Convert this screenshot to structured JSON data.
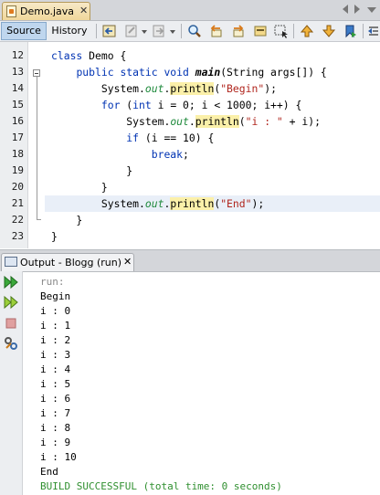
{
  "editor": {
    "file_tab": {
      "label": "Demo.java",
      "close": "✕"
    },
    "toolbar": {
      "source_label": "Source",
      "history_label": "History"
    },
    "line_numbers": [
      "12",
      "13",
      "14",
      "15",
      "16",
      "17",
      "18",
      "19",
      "20",
      "21",
      "22",
      "23"
    ],
    "code": {
      "l12": {
        "kw1": "class",
        "rest": " Demo {"
      },
      "l13": {
        "indent": "    ",
        "kw": "public static void",
        "sp": " ",
        "method": "main",
        "rest": "(String args[]) {"
      },
      "l14": {
        "indent": "        ",
        "cls": "System.",
        "field": "out",
        "dot": ".",
        "method": "println",
        "open": "(",
        "str": "\"Begin\"",
        "close": ");"
      },
      "l15": {
        "indent": "        ",
        "kw1": "for",
        "mid1": " (",
        "kw2": "int",
        "rest": " i = 0; i < 1000; i++) {"
      },
      "l16": {
        "indent": "            ",
        "cls": "System.",
        "field": "out",
        "dot": ".",
        "method": "println",
        "open": "(",
        "str": "\"i : \"",
        "close": " + i);"
      },
      "l17": {
        "indent": "            ",
        "kw1": "if",
        "rest": " (i == 10) {"
      },
      "l18": {
        "indent": "                ",
        "kw1": "break",
        "rest": ";"
      },
      "l19": {
        "text": "            }"
      },
      "l20": {
        "text": "        }"
      },
      "l21": {
        "indent": "        ",
        "cls": "System.",
        "field": "out",
        "dot": ".",
        "method": "println",
        "open": "(",
        "str": "\"End\"",
        "close": ");"
      },
      "l22": {
        "text": "    }"
      },
      "l23": {
        "text": "}"
      }
    }
  },
  "output": {
    "tab_label": "Output - Blogg (run)",
    "tab_close": "✕",
    "lines": {
      "run": "run:",
      "begin": "Begin",
      "i0": "i : 0",
      "i1": "i : 1",
      "i2": "i : 2",
      "i3": "i : 3",
      "i4": "i : 4",
      "i5": "i : 5",
      "i6": "i : 6",
      "i7": "i : 7",
      "i8": "i : 8",
      "i9": "i : 9",
      "i10": "i : 10",
      "end": "End",
      "build": "BUILD SUCCESSFUL (total time: 0 seconds)"
    }
  },
  "icons": {
    "toolbar": [
      "back-nav-icon",
      "last-edit-icon",
      "forward-nav-icon",
      "find-icon",
      "find-prev-icon",
      "find-next-icon",
      "toggle-highlight-icon",
      "select-icon",
      "prev-bookmark-icon",
      "next-bookmark-icon",
      "toggle-bookmark-icon",
      "shift-left-icon"
    ],
    "output_side": [
      "rerun-icon",
      "rerun-with-args-icon",
      "stop-icon",
      "settings-icon"
    ]
  },
  "colors": {
    "keyword": "#0033b3",
    "string": "#b0251d",
    "field": "#1f8a3c",
    "method_highlight": "#fbf0a9",
    "build_success": "#2f8f2f",
    "current_line": "#e9eff8"
  }
}
